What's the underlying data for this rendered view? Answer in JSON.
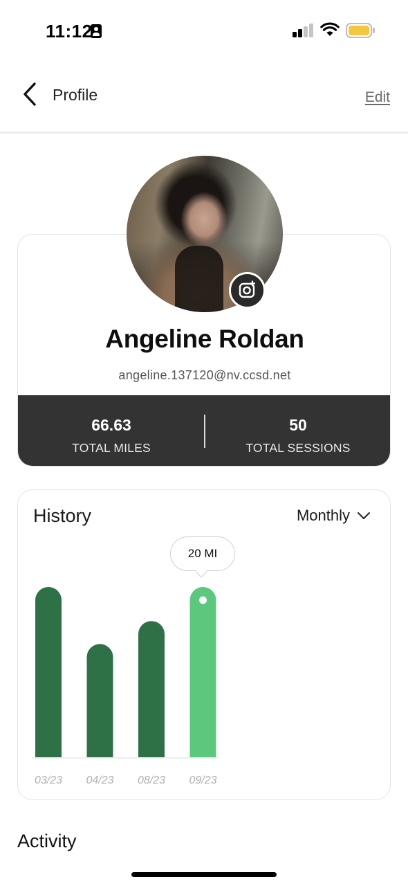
{
  "status_bar": {
    "time": "11:12",
    "signal_bars": 2,
    "battery_color": "#f5c640"
  },
  "header": {
    "title": "Profile",
    "edit_label": "Edit",
    "back_icon": "chevron-left-icon"
  },
  "profile": {
    "name": "Angeline Roldan",
    "email": "angeline.137120@nv.ccsd.net",
    "camera_icon": "instagram-camera-icon",
    "stats": [
      {
        "value": "66.63",
        "label": "TOTAL MILES"
      },
      {
        "value": "50",
        "label": "TOTAL SESSIONS"
      }
    ]
  },
  "history": {
    "title": "History",
    "period": "Monthly",
    "tooltip": "20 MI",
    "colors": {
      "bar": "#2f7147",
      "bar_selected": "#5bc87e"
    }
  },
  "chart_data": {
    "type": "bar",
    "categories": [
      "03/23",
      "04/23",
      "08/23",
      "09/23"
    ],
    "values": [
      20,
      13.3,
      16,
      20
    ],
    "selected_index": 3,
    "title": "",
    "xlabel": "",
    "ylabel": "",
    "ylim": [
      0,
      20
    ]
  },
  "activity": {
    "title": "Activity"
  }
}
